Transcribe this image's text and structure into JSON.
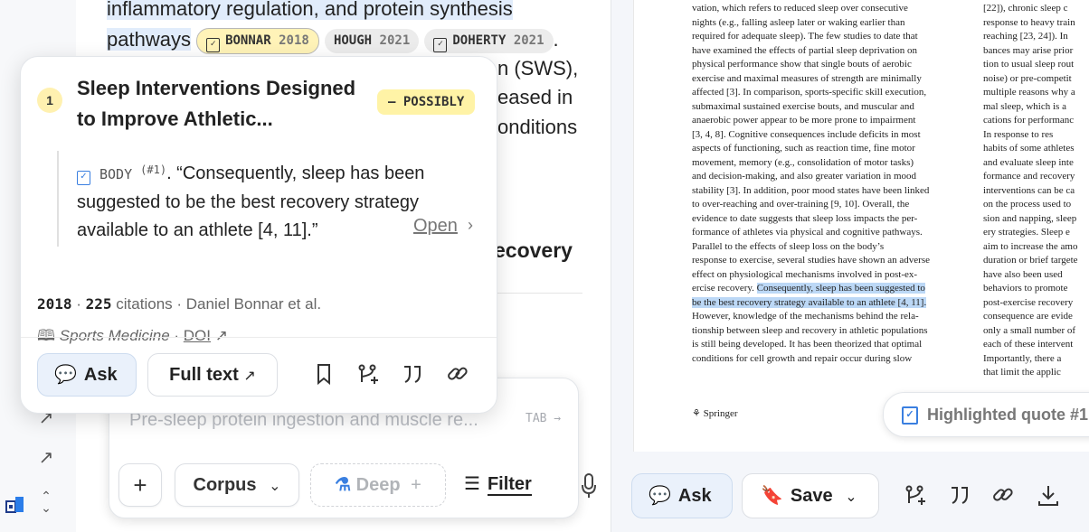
{
  "left_pane": {
    "text_line1": "inflammatory regulation, and protein synthesis",
    "text_line2_prefix": "pathways",
    "text_line2_suffix": ".",
    "citations": [
      {
        "author": "BONNAR",
        "year": "2018"
      },
      {
        "author": "HOUGH",
        "year": "2021"
      },
      {
        "author": "DOHERTY",
        "year": "2021"
      }
    ],
    "fragment_sws": "n (SWS),",
    "fragment_eased": "eased in",
    "fragment_onditions": "onditions",
    "fragment_ecovery": "ecovery",
    "composer": {
      "placeholder": "Pre-sleep protein ingestion and muscle re...",
      "tab_hint": "TAB →",
      "plus_label": "+",
      "corpus_label": "Corpus",
      "deep_label": "Deep",
      "deep_plus": "+",
      "filter_label": "Filter"
    }
  },
  "popover": {
    "rank": "1",
    "title": "Sleep Interventions Designed to Improve Athletic...",
    "verdict": "– POSSIBLY",
    "quote_source": "BODY",
    "quote_index": "(#1)",
    "quote_text": ". “Consequently, sleep has been suggested to be the best recovery strategy available to an athlete [4, 11].”",
    "open_label": "Open",
    "year": "2018",
    "citation_count": "225",
    "citations_word": "citations",
    "authors": "Daniel Bonnar et al.",
    "journal": "Sports Medicine",
    "doi_label": "DOI",
    "ask_label": "Ask",
    "fulltext_label": "Full text"
  },
  "pdf": {
    "col1": [
      "vation, which refers to reduced sleep over consecutive",
      "nights (e.g., falling asleep later or waking earlier than",
      "required for adequate sleep). The few studies to date that",
      "have examined the effects of partial sleep deprivation on",
      "physical performance show that single bouts of aerobic",
      "exercise and maximal measures of strength are minimally",
      "affected [3]. In comparison, sports-specific skill execution,",
      "submaximal sustained exercise bouts, and muscular and",
      "anaerobic power appear to be more prone to impairment",
      "[3, 4, 8]. Cognitive consequences include deficits in most",
      "aspects of functioning, such as reaction time, fine motor",
      "movement, memory (e.g., consolidation of motor tasks)",
      "and decision-making, and also greater variation in mood",
      "stability [3]. In addition, poor mood states have been linked",
      "to over-reaching and over-training [9, 10]. Overall, the",
      "evidence to date suggests that sleep loss impacts the per-",
      "formance of athletes via physical and cognitive pathways.",
      "   Parallel to the effects of sleep loss on the body’s",
      "response to exercise, several studies have shown an adverse",
      "effect on physiological mechanisms involved in post-ex-",
      "ercise recovery. ",
      "be the best recovery strategy available to an athlete [4, 11].",
      "However, knowledge of the mechanisms behind the rela-",
      "tionship between sleep and recovery in athletic populations",
      "is still being developed. It has been theorized that optimal",
      "conditions for cell growth and repair occur during slow"
    ],
    "col1_highlight_start": "Consequently, sleep has been suggested to",
    "col2": [
      "[22]), chronic sleep c",
      "response to heavy train",
      "reaching [23, 24]). In",
      "bances may arise prior",
      "tion to usual sleep rout",
      "noise) or pre-competit",
      "multiple reasons why a",
      "mal sleep, which is a",
      "cations for performanc",
      "   In response to res",
      "habits of some athletes",
      "and evaluate sleep inte",
      "formance and recovery",
      "interventions can be ca",
      "on the process used to",
      "sion and napping, sleep",
      "ery strategies. Sleep e",
      "aim to increase the amo",
      "duration or brief targete",
      "have also been used",
      "behaviors to promote",
      "post-exercise recovery",
      "consequence are evide",
      "only a small number of",
      "each of these intervent",
      "   Importantly, there a",
      "that limit the applic"
    ],
    "publisher": "Springer",
    "highlighted_quote_label": "Highlighted quote",
    "highlighted_quote_num": "#1",
    "ask_label": "Ask",
    "save_label": "Save"
  }
}
